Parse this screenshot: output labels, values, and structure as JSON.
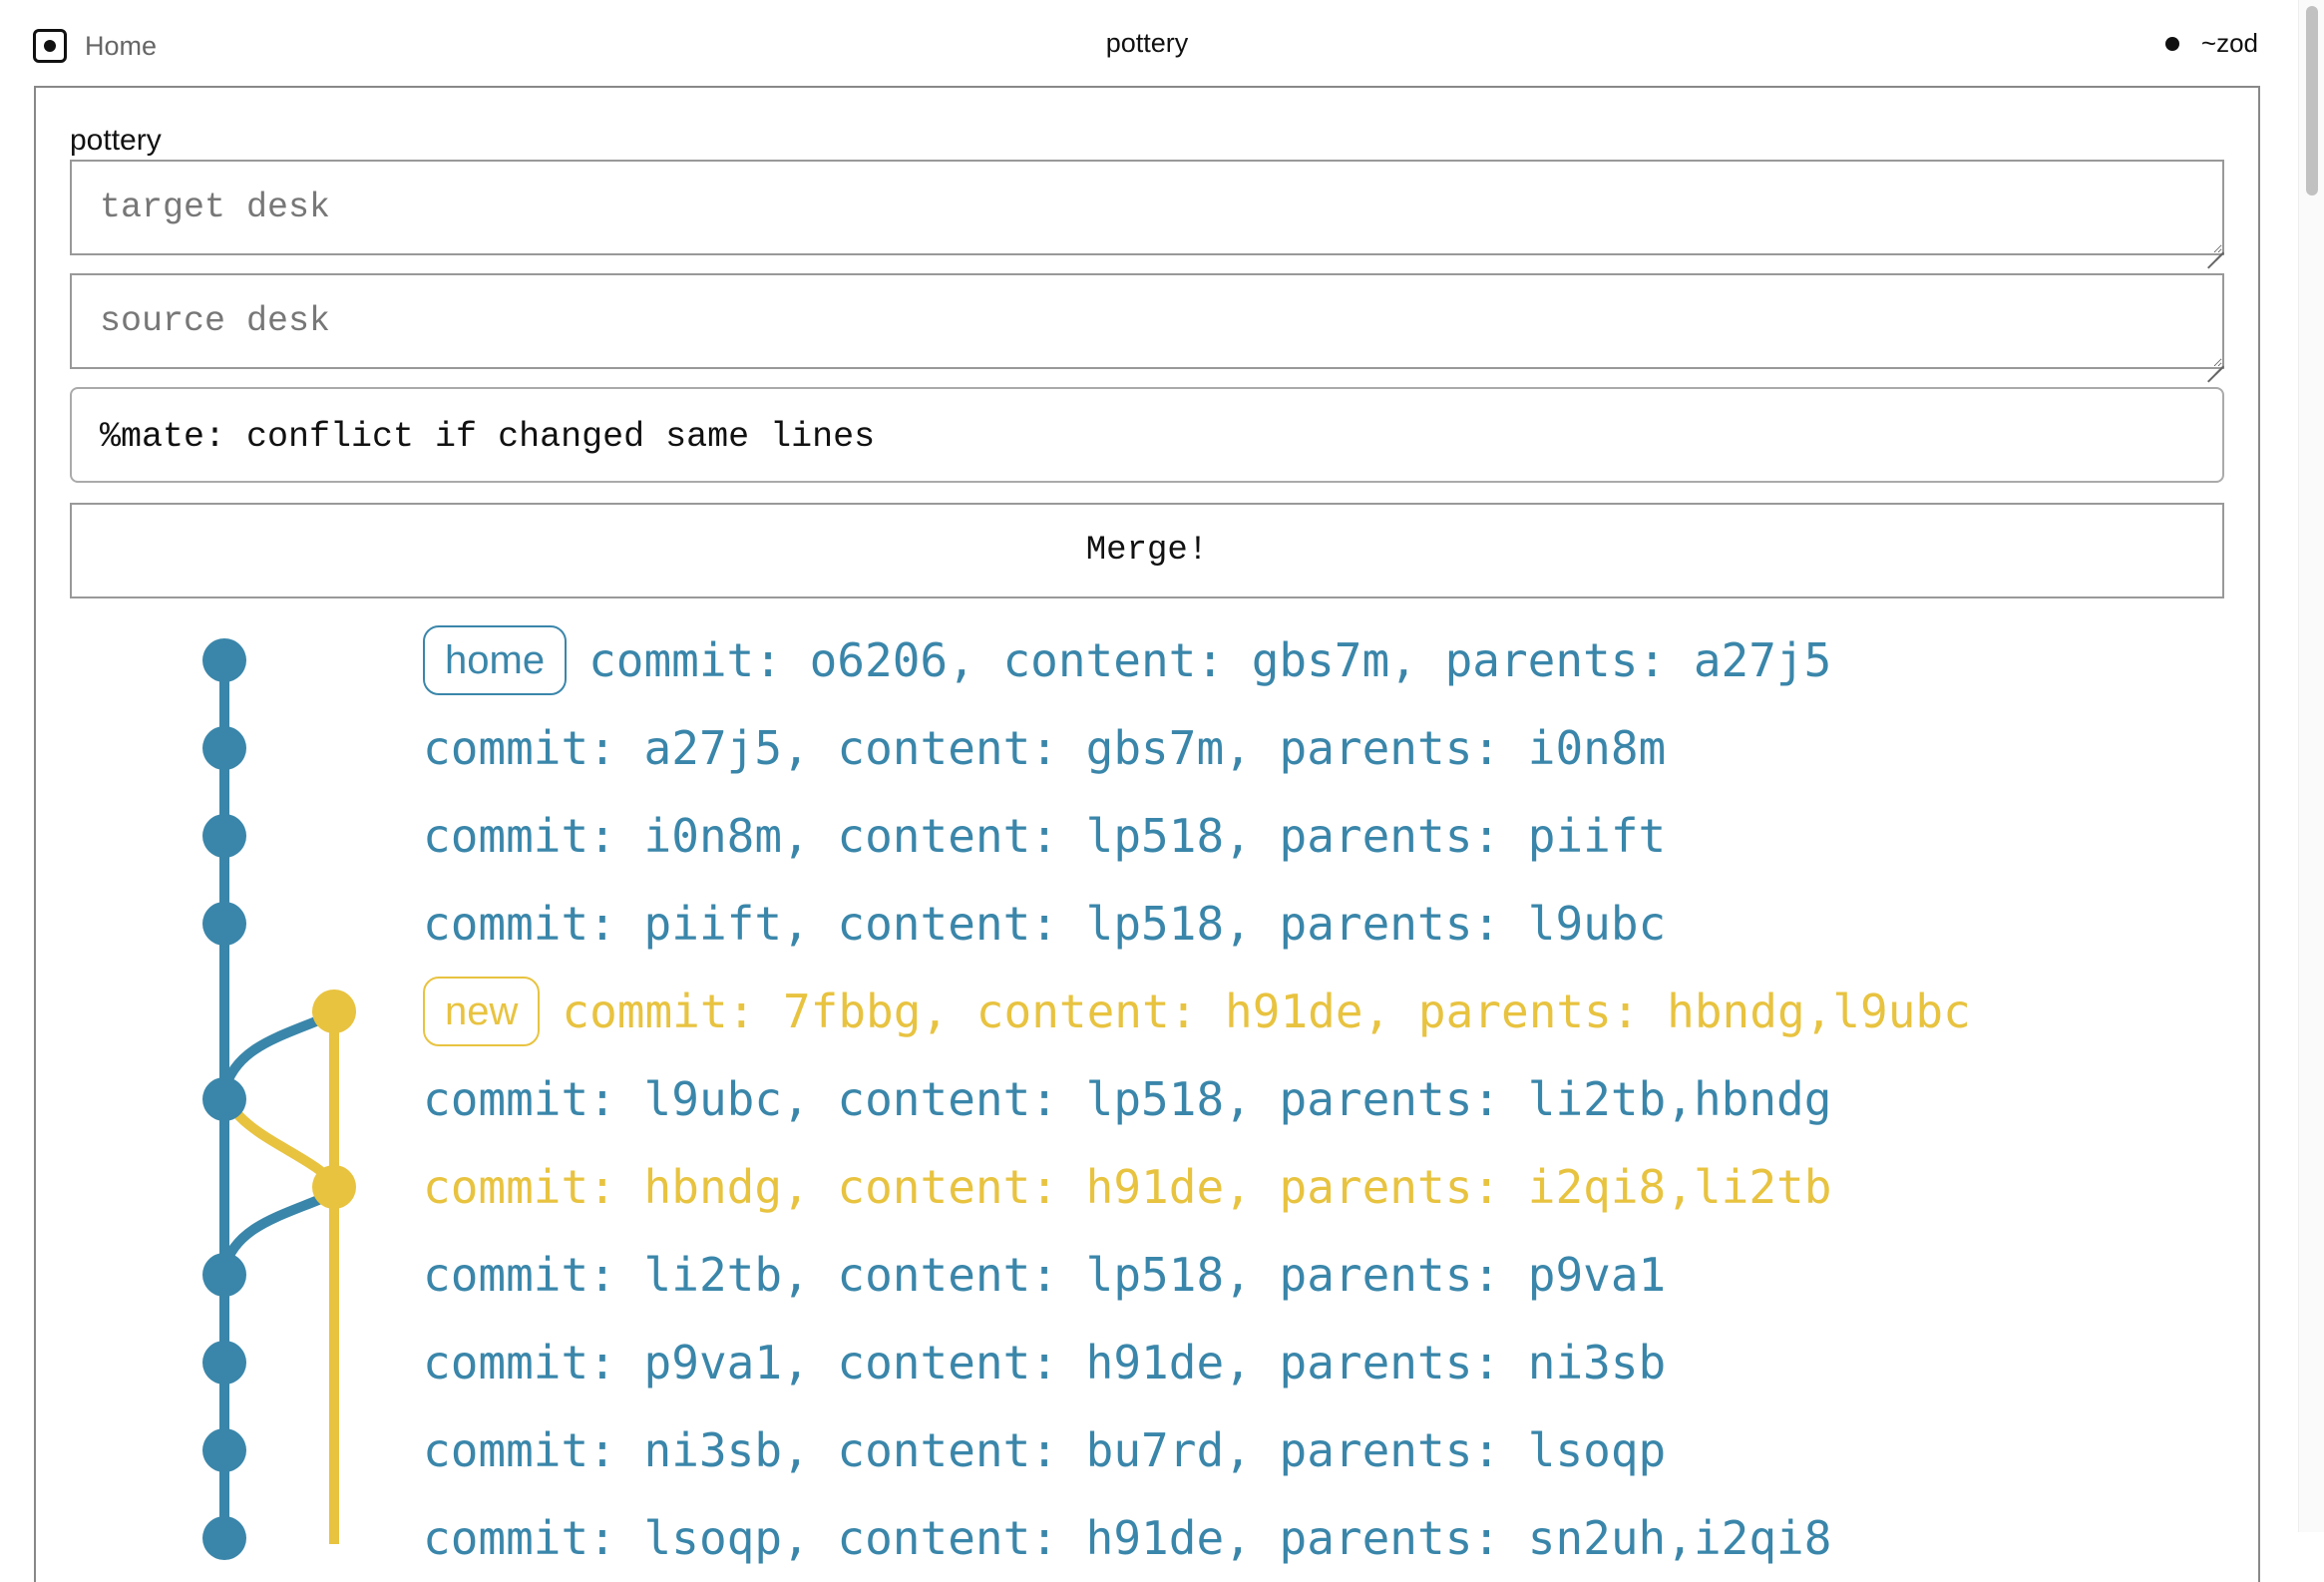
{
  "topbar": {
    "home_label": "Home",
    "app_title": "pottery",
    "user": "~zod"
  },
  "form": {
    "title": "pottery",
    "target_placeholder": "target desk",
    "source_placeholder": "source desk",
    "strategy_value": "%mate: conflict if changed same lines",
    "merge_label": "Merge!"
  },
  "colors": {
    "branch_blue": "#3a86aa",
    "branch_gold": "#e8c340"
  },
  "commits": [
    {
      "tag": "home",
      "text": "commit: o6206, content: gbs7m, parents: a27j5",
      "branch": "blue"
    },
    {
      "tag": "",
      "text": "commit: a27j5, content: gbs7m, parents: i0n8m",
      "branch": "blue"
    },
    {
      "tag": "",
      "text": "commit: i0n8m, content: lp518, parents: piift",
      "branch": "blue"
    },
    {
      "tag": "",
      "text": "commit: piift, content: lp518, parents: l9ubc",
      "branch": "blue"
    },
    {
      "tag": "new",
      "text": "commit: 7fbbg, content: h91de, parents: hbndg,l9ubc",
      "branch": "gold"
    },
    {
      "tag": "",
      "text": "commit: l9ubc, content: lp518, parents: li2tb,hbndg",
      "branch": "blue"
    },
    {
      "tag": "",
      "text": "commit: hbndg, content: h91de, parents: i2qi8,li2tb",
      "branch": "gold"
    },
    {
      "tag": "",
      "text": "commit: li2tb, content: lp518, parents: p9va1",
      "branch": "blue"
    },
    {
      "tag": "",
      "text": "commit: p9va1, content: h91de, parents: ni3sb",
      "branch": "blue"
    },
    {
      "tag": "",
      "text": "commit: ni3sb, content: bu7rd, parents: lsoqp",
      "branch": "blue"
    },
    {
      "tag": "",
      "text": "commit: lsoqp, content: h91de, parents: sn2uh,i2qi8",
      "branch": "blue"
    }
  ]
}
